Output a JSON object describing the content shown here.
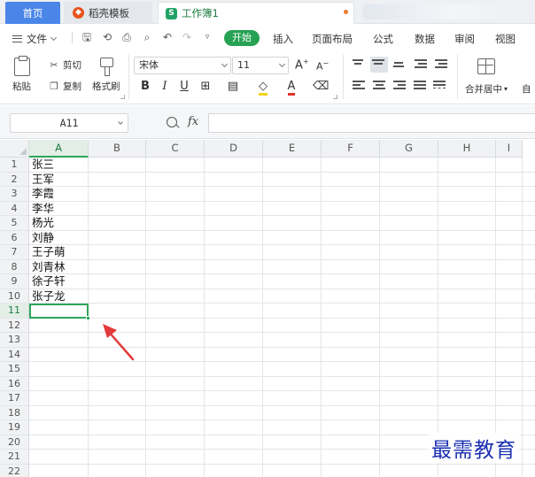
{
  "tabs": {
    "home": "首页",
    "templates": "稻壳模板",
    "workbook": "工作簿1"
  },
  "menu": {
    "file": "文件",
    "items": [
      "开始",
      "插入",
      "页面布局",
      "公式",
      "数据",
      "审阅",
      "视图"
    ]
  },
  "ribbon": {
    "paste": "粘贴",
    "cut": "剪切",
    "copy": "复制",
    "format_painter": "格式刷",
    "font_name": "宋体",
    "font_size": "11",
    "merge_center": "合并居中",
    "auto_wrap_partial": "自"
  },
  "formula_bar": {
    "name_box": "A11",
    "fx_label": "fx",
    "formula": ""
  },
  "grid": {
    "columns": [
      "A",
      "B",
      "C",
      "D",
      "E",
      "F",
      "G",
      "H",
      "I"
    ],
    "rows": [
      "1",
      "2",
      "3",
      "4",
      "5",
      "6",
      "7",
      "8",
      "9",
      "10",
      "11",
      "12",
      "13",
      "14",
      "15",
      "16",
      "17",
      "18",
      "19",
      "20",
      "21",
      "22"
    ],
    "active_column": "A",
    "active_row": "11",
    "column_a_values": [
      "张三",
      "王军",
      "李霞",
      "李华",
      "杨光",
      "刘静",
      "王子萌",
      "刘青林",
      "徐子轩",
      "张子龙"
    ]
  },
  "annotation": {
    "arrow_color": "#e23b3b"
  },
  "watermark": "最需教育",
  "colors": {
    "accent_green": "#27a153",
    "selection_green": "#2fa45a",
    "home_tab_blue": "#4a86e8",
    "watermark_blue": "#1a2fb0"
  }
}
